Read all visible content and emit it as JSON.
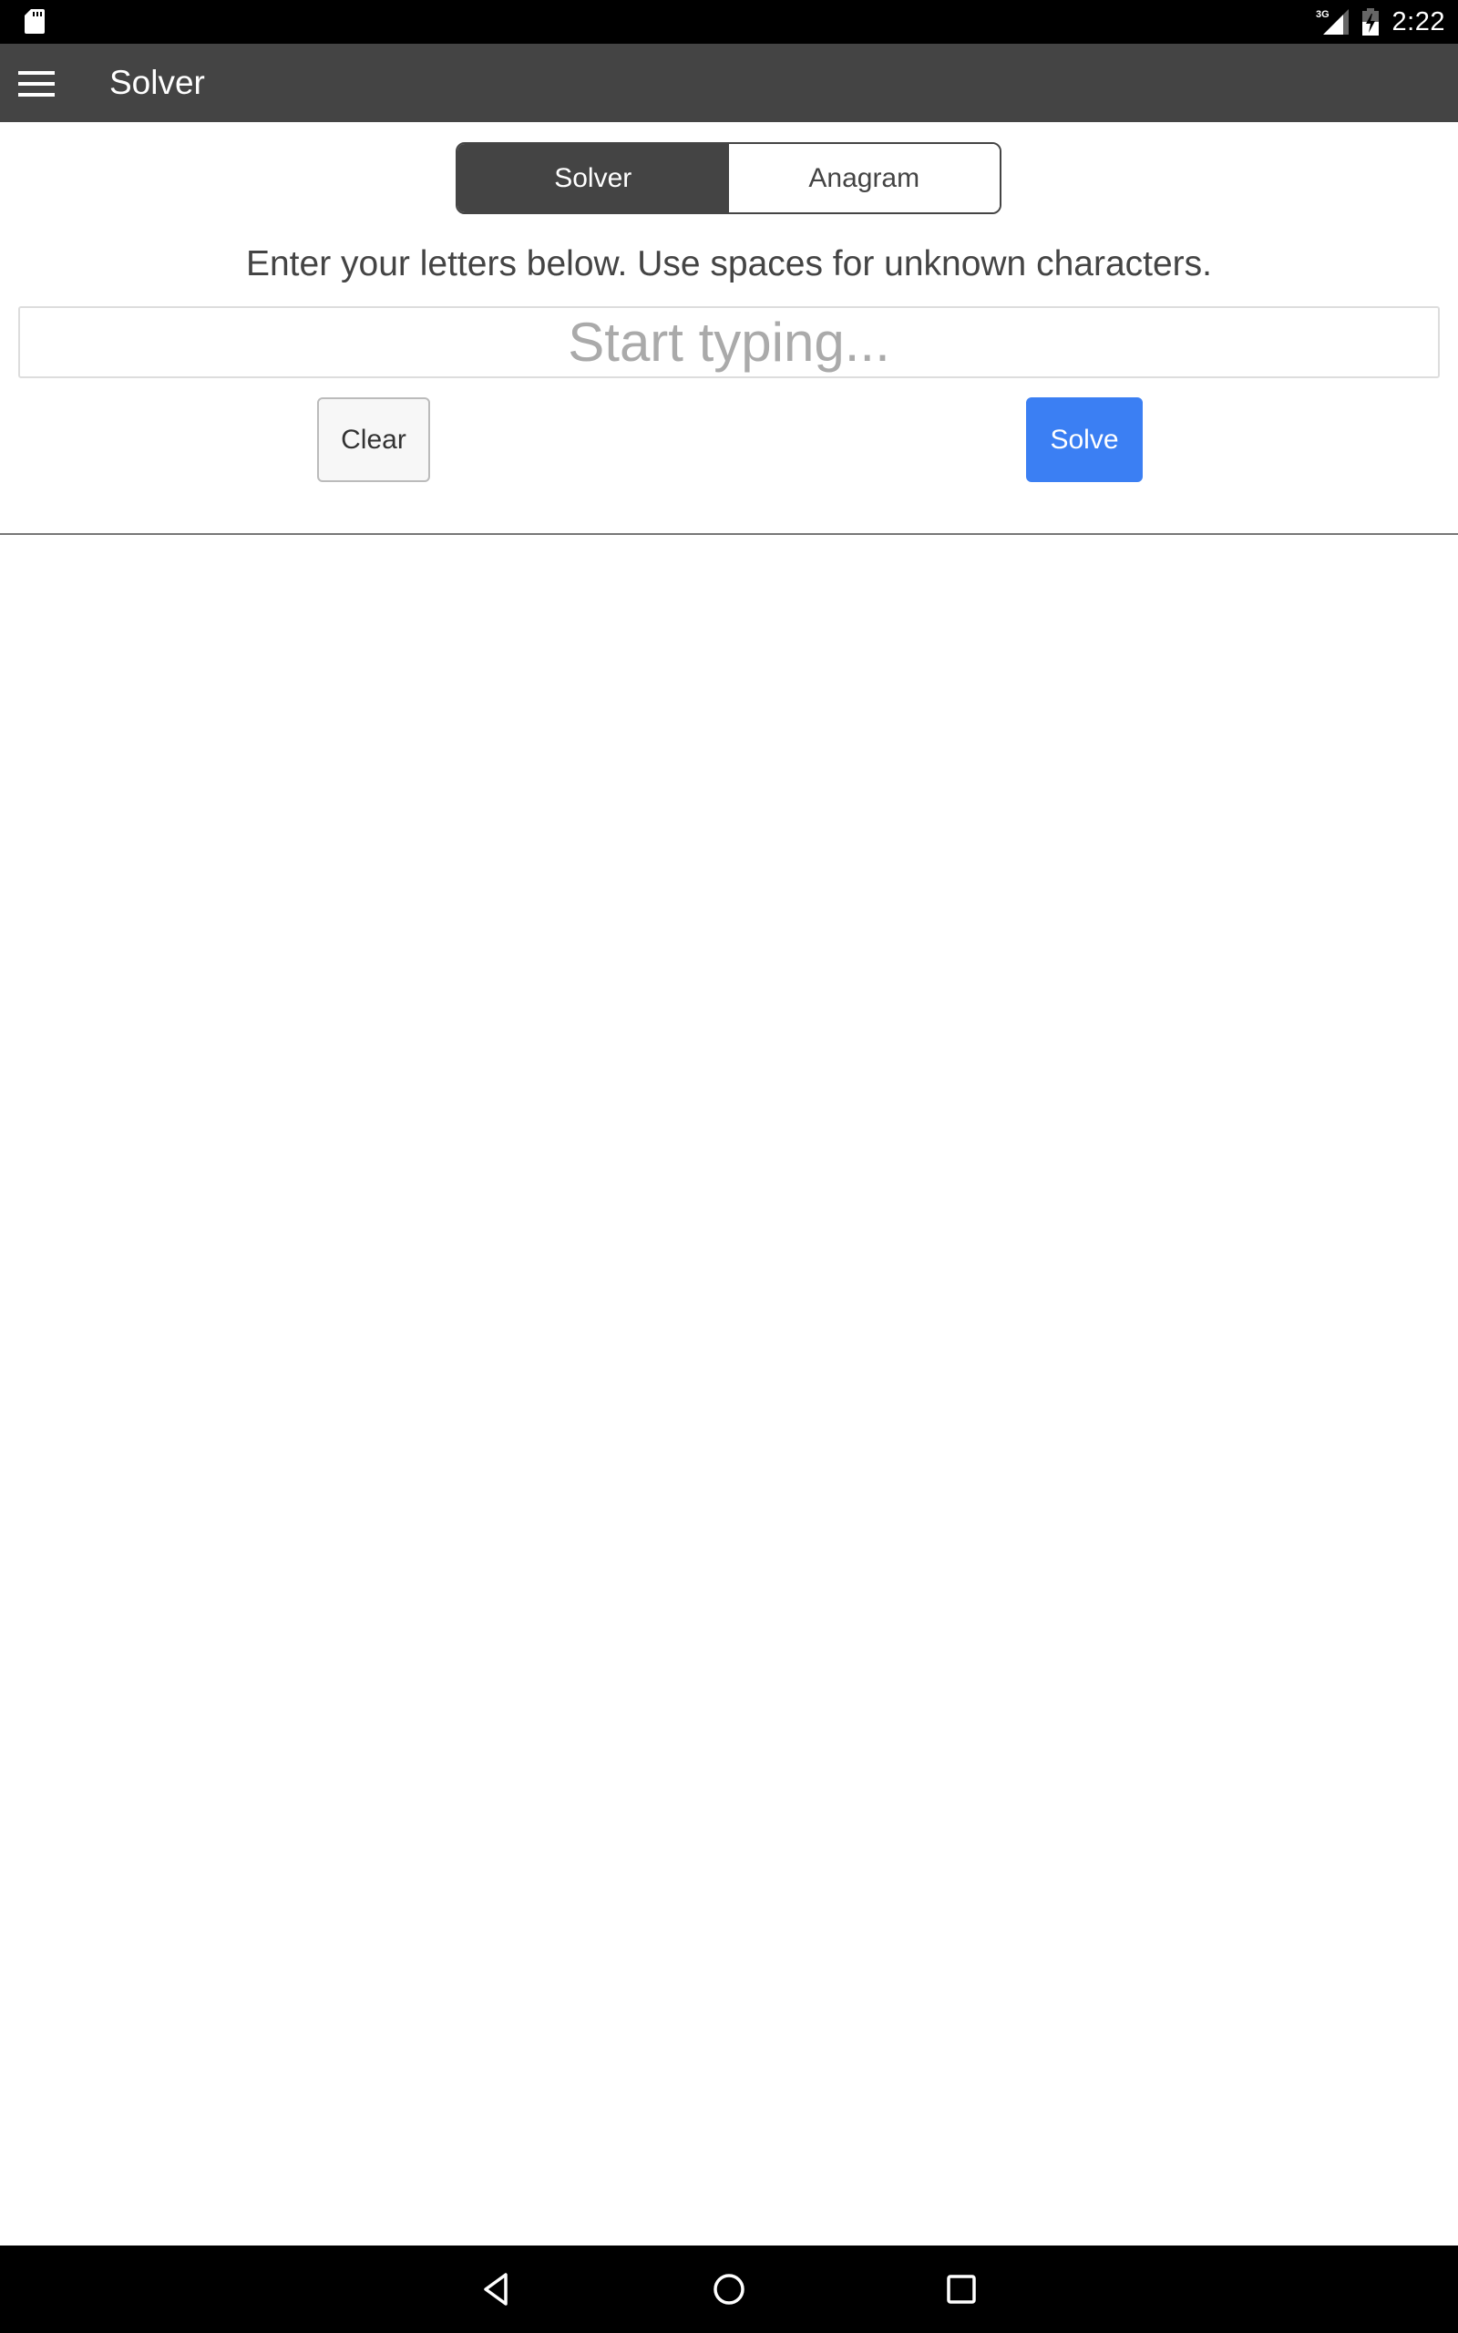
{
  "status_bar": {
    "time": "2:22",
    "network_type": "3G",
    "icons": [
      "sd-card-icon",
      "signal-icon",
      "battery-charging-icon"
    ]
  },
  "toolbar": {
    "menu_icon": "hamburger-menu-icon",
    "title": "Solver"
  },
  "mode_tabs": [
    {
      "label": "Solver",
      "active": true
    },
    {
      "label": "Anagram",
      "active": false
    }
  ],
  "instructions": "Enter your letters below. Use spaces for unknown characters.",
  "letters_input": {
    "value": "",
    "placeholder": "Start typing..."
  },
  "buttons": {
    "clear_label": "Clear",
    "solve_label": "Solve"
  },
  "colors": {
    "toolbar": "#444444",
    "accent": "#3b7ff3"
  },
  "nav_bar": {
    "icons": [
      "back-icon",
      "home-icon",
      "recents-icon"
    ]
  }
}
